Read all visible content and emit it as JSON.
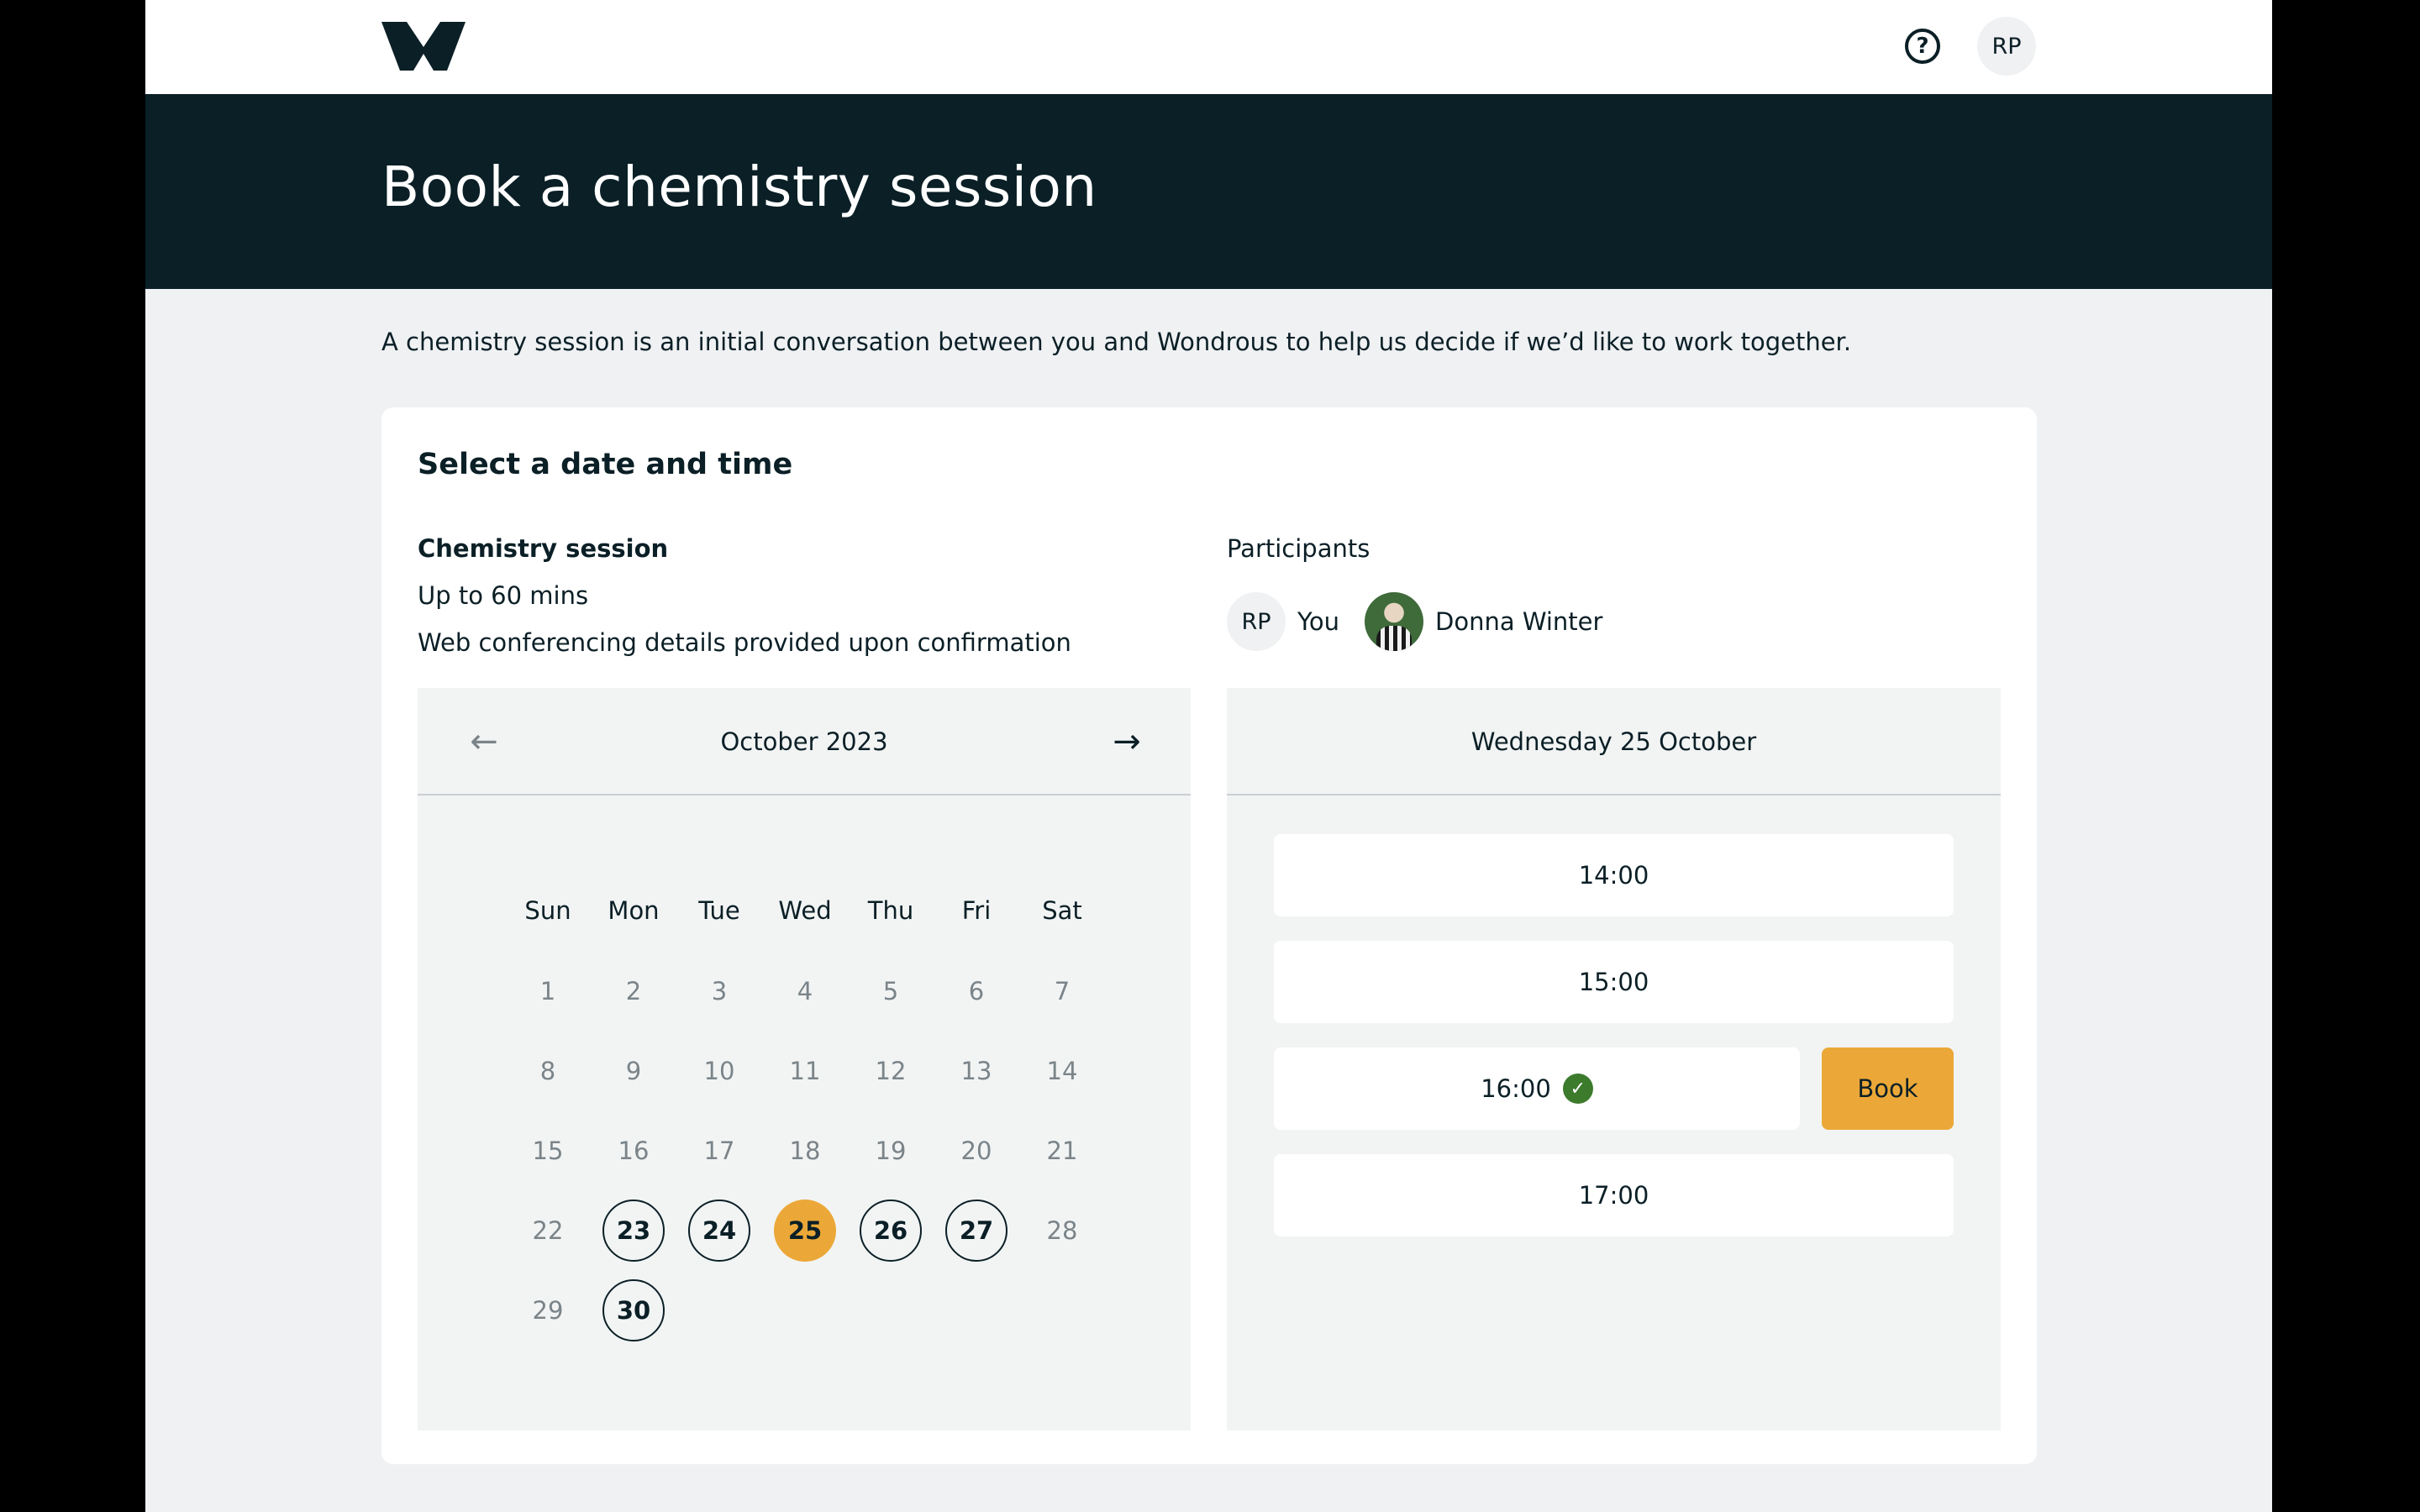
{
  "header": {
    "help_icon_glyph": "?",
    "user_initials": "RP"
  },
  "hero": {
    "title": "Book a chemistry session"
  },
  "intro": "A chemistry session is an initial conversation between you and Wondrous to help us decide if we’d like to work together.",
  "card": {
    "title": "Select a date and time",
    "session": {
      "name": "Chemistry session",
      "duration": "Up to 60 mins",
      "details": "Web conferencing details provided upon confirmation"
    },
    "participants": {
      "label": "Participants",
      "you_initials": "RP",
      "you_label": "You",
      "other_name": "Donna Winter"
    }
  },
  "calendar": {
    "month_label": "October 2023",
    "prev_icon": "←",
    "next_icon": "→",
    "weekdays": [
      "Sun",
      "Mon",
      "Tue",
      "Wed",
      "Thu",
      "Fri",
      "Sat"
    ],
    "days": [
      "1",
      "2",
      "3",
      "4",
      "5",
      "6",
      "7",
      "8",
      "9",
      "10",
      "11",
      "12",
      "13",
      "14",
      "15",
      "16",
      "17",
      "18",
      "19",
      "20",
      "21",
      "22",
      "23",
      "24",
      "25",
      "26",
      "27",
      "28",
      "29",
      "30"
    ],
    "available_days": [
      "23",
      "24",
      "26",
      "27",
      "30"
    ],
    "selected_day": "25",
    "accent_color": "#eba838"
  },
  "times": {
    "date_label": "Wednesday 25 October",
    "slots": [
      "14:00",
      "15:00",
      "16:00",
      "17:00"
    ],
    "selected_slot": "16:00",
    "check_icon": "✓",
    "book_label": "Book",
    "check_color": "#3c7a2c"
  }
}
